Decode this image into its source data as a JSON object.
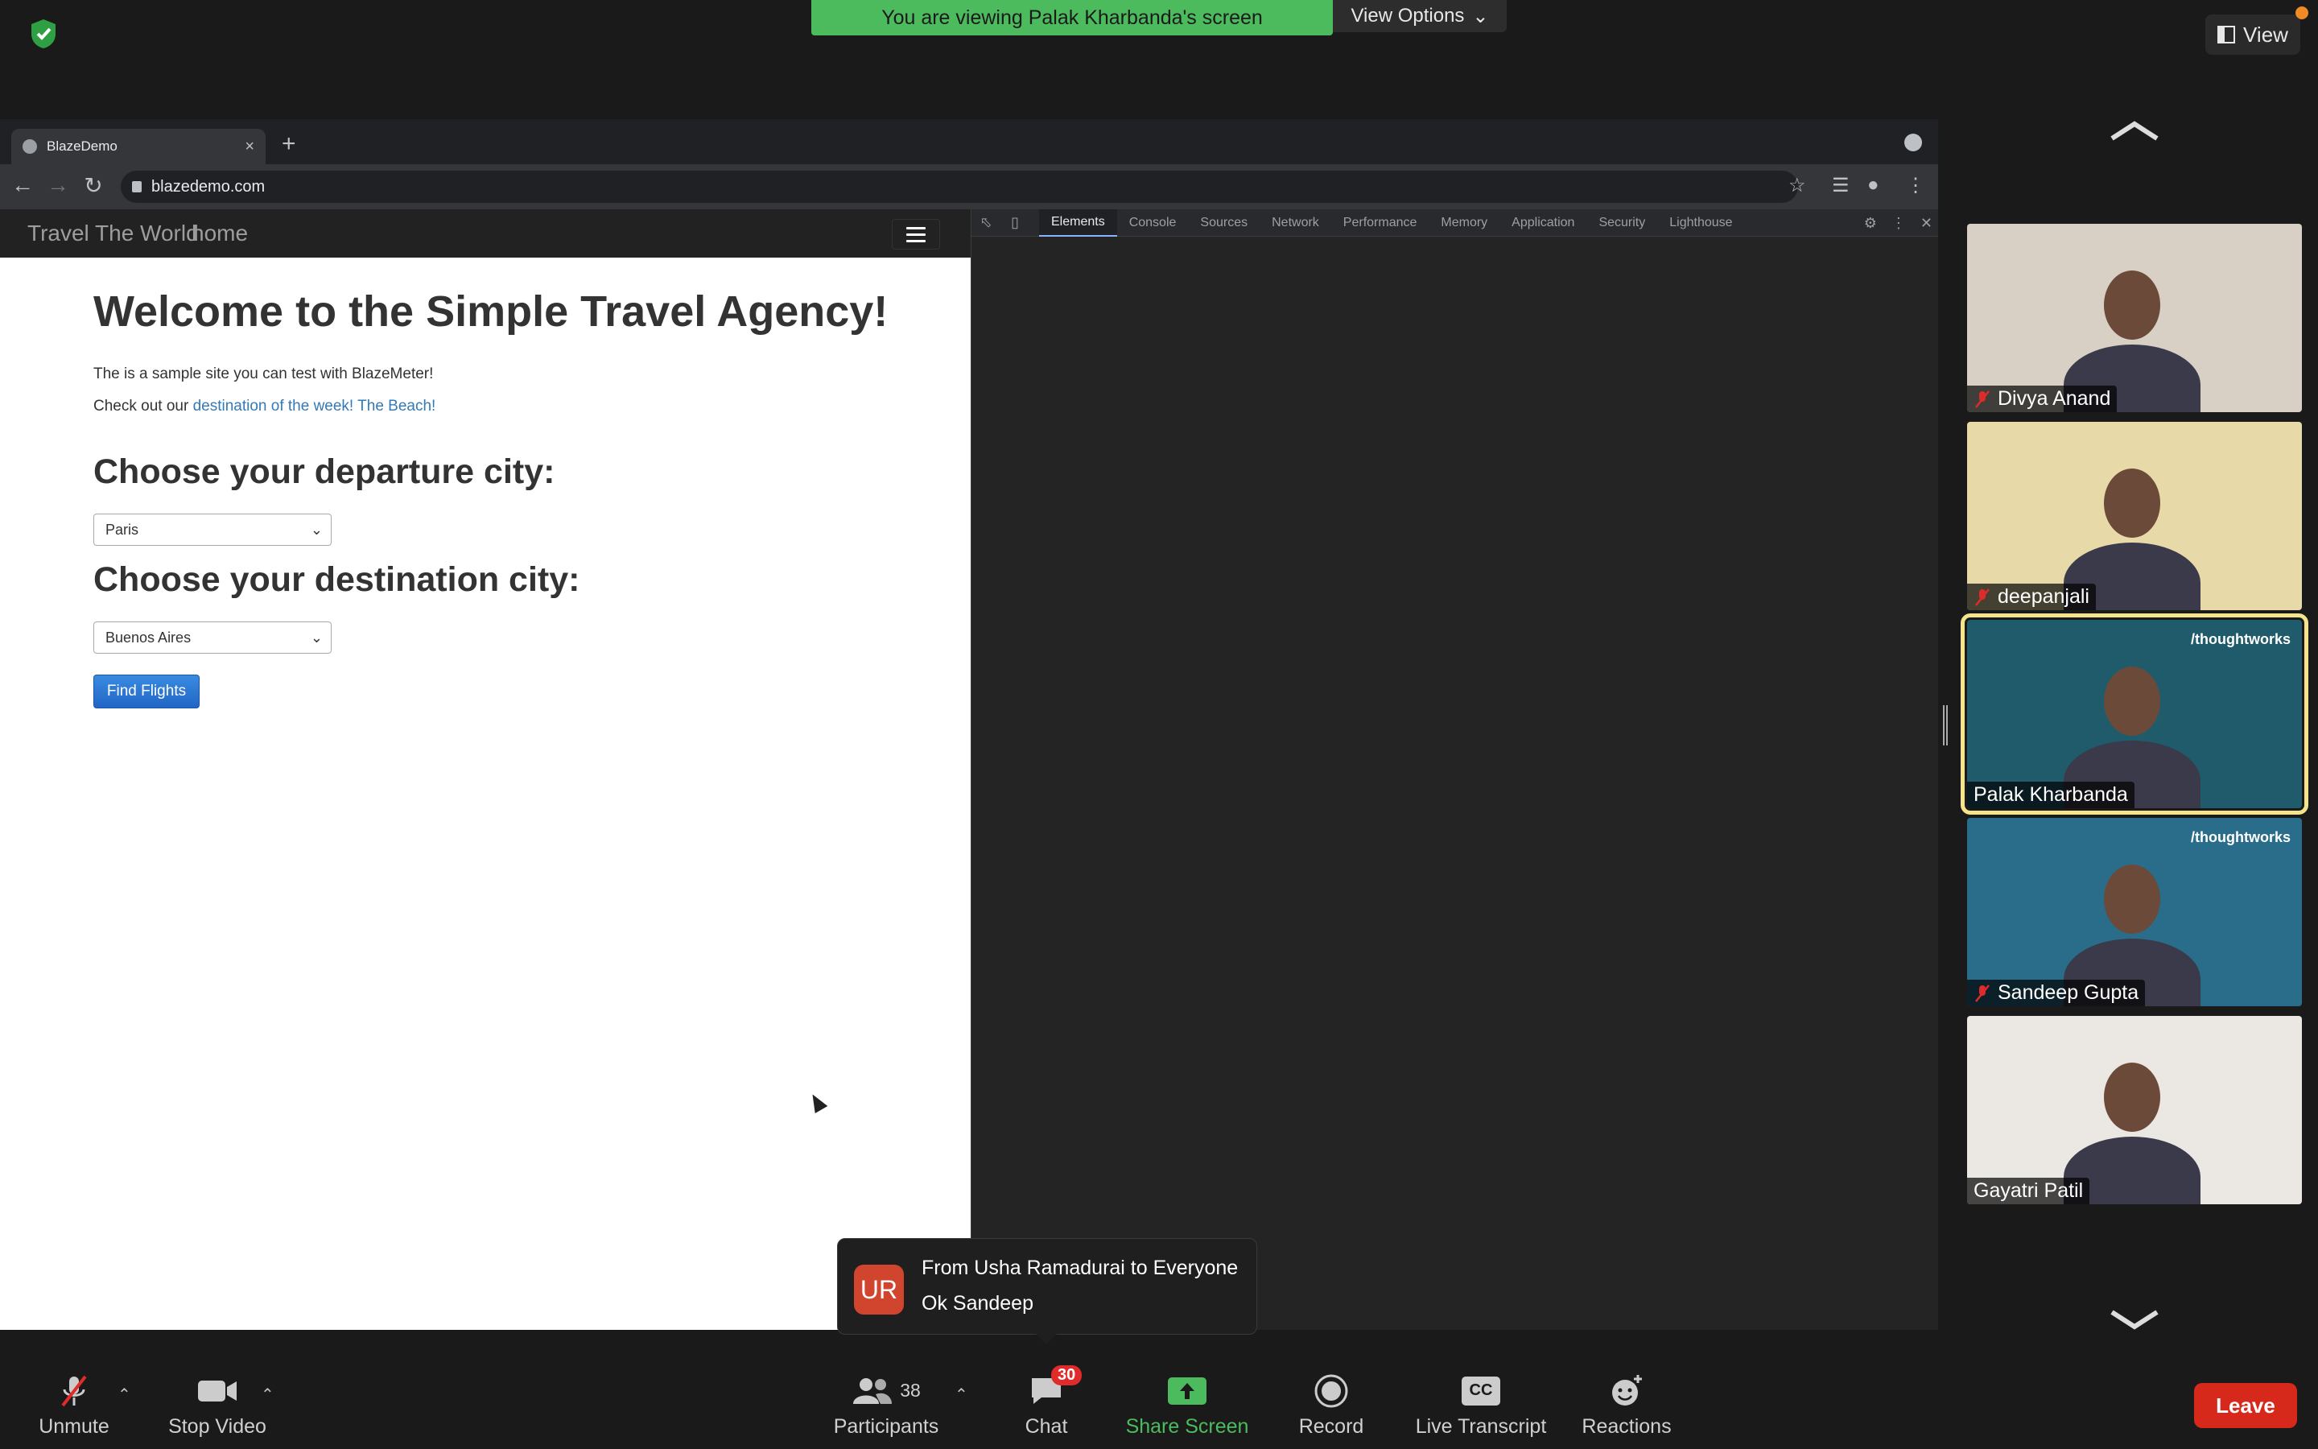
{
  "zoom": {
    "viewing_banner": "You are viewing Palak Kharbanda's screen",
    "view_options_label": "View Options",
    "view_label": "View"
  },
  "browser": {
    "tab_title": "BlazeDemo",
    "url": "blazedemo.com"
  },
  "site": {
    "brand": "Travel The World",
    "nav_home": "home",
    "heading": "Welcome to the Simple Travel Agency!",
    "intro": "The is a sample site you can test with BlazeMeter!",
    "check_prefix": "Check out our ",
    "check_link": "destination of the week! The Beach!",
    "departure_heading": "Choose your departure city:",
    "departure_value": "Paris",
    "destination_heading": "Choose your destination city:",
    "destination_value": "Buenos Aires",
    "find_button": "Find Flights"
  },
  "devtools": {
    "tabs": [
      "Elements",
      "Console",
      "Sources",
      "Network",
      "Performance",
      "Memory",
      "Application",
      "Security",
      "Lighthouse"
    ],
    "active_tab": "Elements"
  },
  "participants_gallery": [
    {
      "name": "Divya Anand",
      "muted": true,
      "bg": "#d8d0c4"
    },
    {
      "name": "deepanjali",
      "muted": true,
      "bg": "#e8d9a8"
    },
    {
      "name": "Palak Kharbanda",
      "muted": false,
      "bg": "#1f5b6b",
      "active": true,
      "watermark": "/thoughtworks"
    },
    {
      "name": "Sandeep Gupta",
      "muted": true,
      "bg": "#2a6d8a",
      "watermark": "/thoughtworks"
    },
    {
      "name": "Gayatri Patil",
      "muted": false,
      "bg": "#ebe7e2"
    }
  ],
  "chat_toast": {
    "initials": "UR",
    "from": "From Usha Ramadurai to Everyone",
    "message": "Ok Sandeep"
  },
  "toolbar": {
    "unmute": "Unmute",
    "stop_video": "Stop Video",
    "participants": "Participants",
    "participants_count": "38",
    "chat": "Chat",
    "chat_badge": "30",
    "share_screen": "Share Screen",
    "record": "Record",
    "live_transcript": "Live Transcript",
    "cc": "CC",
    "reactions": "Reactions",
    "leave": "Leave"
  },
  "colors": {
    "share_green": "#4cbb5e",
    "leave_red": "#d6291c",
    "active_speaker": "#f4e58d",
    "link_blue": "#337ab7"
  }
}
